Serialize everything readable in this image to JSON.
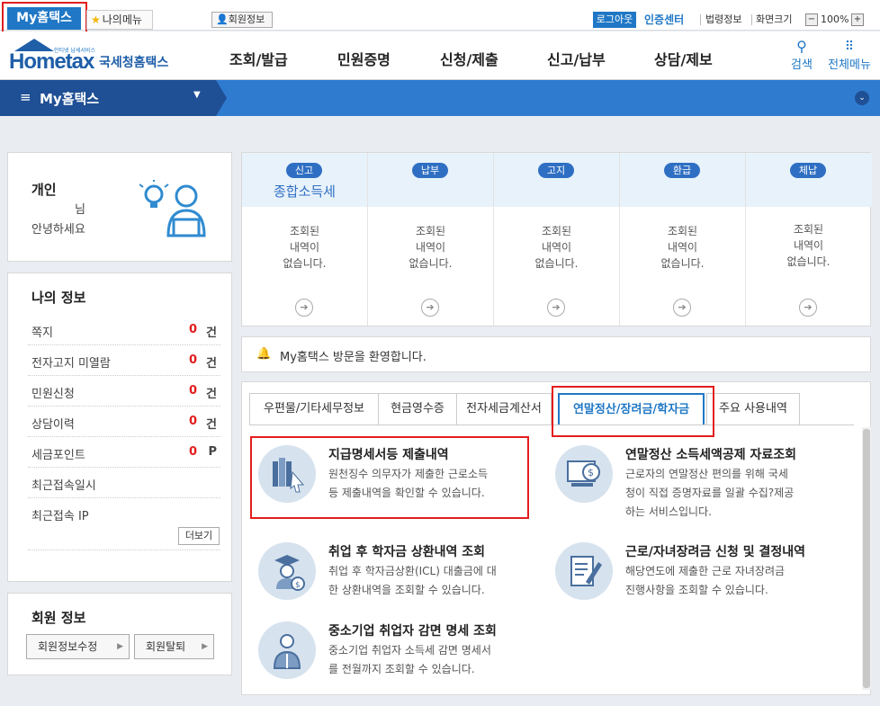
{
  "topbar": {
    "my_hometax": "My홈택스",
    "my_menu": "나의메뉴",
    "member_info": "회원정보",
    "login": "로그아웃",
    "cert_center": "인증센터",
    "law_info": "법령정보",
    "screen_size": "화면크기",
    "zoom_minus": "−",
    "zoom_value": "100%",
    "zoom_plus": "+"
  },
  "header": {
    "logo_small": "안티넷 납세서비스",
    "logo_home": "Hometax",
    "logo_kr": "국세청홈택스",
    "gnb": [
      "조회/발급",
      "민원증명",
      "신청/제출",
      "신고/납부",
      "상담/제보"
    ],
    "search_label": "검색",
    "allmenu_label": "전체메뉴"
  },
  "navbar": {
    "title": "My홈택스"
  },
  "profile": {
    "type": "개인",
    "name_suffix": "님",
    "greeting": "안녕하세요"
  },
  "myinfo": {
    "title": "나의 정보",
    "rows": [
      {
        "label": "쪽지",
        "value": "0",
        "unit": "건"
      },
      {
        "label": "전자고지 미열람",
        "value": "0",
        "unit": "건"
      },
      {
        "label": "민원신청",
        "value": "0",
        "unit": "건"
      },
      {
        "label": "상담이력",
        "value": "0",
        "unit": "건"
      },
      {
        "label": "세금포인트",
        "value": "0",
        "unit": "P"
      },
      {
        "label": "최근접속일시",
        "value": "",
        "unit": ""
      },
      {
        "label": "최근접속 IP",
        "value": "",
        "unit": ""
      }
    ],
    "more": "더보기"
  },
  "member": {
    "title": "회원 정보",
    "edit": "회원정보수정",
    "withdraw": "회원탈퇴"
  },
  "status": [
    {
      "badge": "신고",
      "sub": "종합소득세",
      "msg": [
        "조회된",
        "내역이",
        "없습니다."
      ]
    },
    {
      "badge": "납부",
      "sub": "",
      "msg": [
        "조회된",
        "내역이",
        "없습니다."
      ]
    },
    {
      "badge": "고지",
      "sub": "",
      "msg": [
        "조회된",
        "내역이",
        "없습니다."
      ]
    },
    {
      "badge": "환급",
      "sub": "",
      "msg": [
        "조회된",
        "내역이",
        "없습니다."
      ]
    },
    {
      "badge": "체납",
      "sub": "",
      "msg": [
        "조회된",
        "내역이",
        "없습니다."
      ]
    }
  ],
  "welcome": "My홈택스 방문을 환영합니다.",
  "tabs": [
    "우편물/기타세무정보",
    "현금영수증",
    "전자세금계산서",
    "연말정산/장려금/학자금",
    "주요 사용내역"
  ],
  "services": [
    {
      "title": "지급명세서등 제출내역",
      "desc": [
        "원천징수 의무자가 제출한 근로소득",
        "등 제출내역을 확인할 수 있습니다."
      ],
      "icon": "books-icon"
    },
    {
      "title": "연말정산 소득세액공제 자료조회",
      "desc": [
        "근로자의 연말정산 편의를 위해 국세",
        "청이 직접 증명자료를 일괄 수집?제공",
        "하는 서비스입니다."
      ],
      "icon": "monitor-coin-icon"
    },
    {
      "title": "취업 후 학자금 상환내역 조회",
      "desc": [
        "취업 후 학자금상환(ICL) 대출금에 대",
        "한 상환내역을 조회할 수 있습니다."
      ],
      "icon": "graduate-coin-icon"
    },
    {
      "title": "근로/자녀장려금 신청 및 결정내역",
      "desc": [
        "해당연도에 제출한 근로 자녀장려금",
        "진행사항을 조회할 수 있습니다."
      ],
      "icon": "document-pen-icon"
    },
    {
      "title": "중소기업 취업자 감면 명세 조회",
      "desc": [
        "중소기업 취업자 소득세 감면 명세서",
        "를 전월까지 조회할 수 있습니다."
      ],
      "icon": "worker-icon"
    }
  ]
}
